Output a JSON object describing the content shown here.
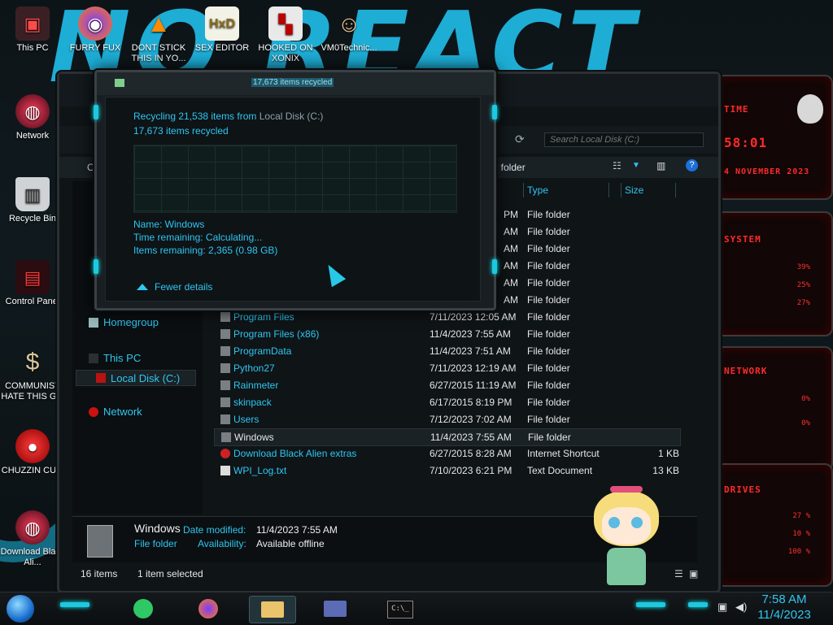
{
  "desktop": {
    "brand_text": "NO REACT",
    "icons": [
      {
        "label": "This PC"
      },
      {
        "label": "FURRY FUX"
      },
      {
        "label": "DONT STICK THIS IN YO..."
      },
      {
        "label": "SEX EDITOR"
      },
      {
        "label": "HOOKED ON XONIX"
      },
      {
        "label": "VM0Technic..."
      },
      {
        "label": "Network"
      },
      {
        "label": "Recycle Bin"
      },
      {
        "label": "Control Panel"
      },
      {
        "label": "COMMUNIST HATE THIS G..."
      },
      {
        "label": "CHUZZIN CUM"
      },
      {
        "label": "Download Black Ali..."
      }
    ]
  },
  "rainmeter": {
    "time_title": "TIME",
    "time_value": "58:01",
    "date_value": "4 NOVEMBER 2023",
    "system_title": "SYSTEM",
    "system_pcts": [
      "39%",
      "25%",
      "27%"
    ],
    "network_title": "NETWORK",
    "network_pcts": [
      "0%",
      "0%"
    ],
    "drives_title": "DRIVES",
    "drive_pcts": [
      "27 %",
      "10 %",
      "100 %"
    ]
  },
  "explorer": {
    "search_placeholder": "Search Local Disk (C:)",
    "toolbar_left": "Or",
    "toolbar_new_folder": "ew folder",
    "columns": {
      "type": "Type",
      "size": "Size"
    },
    "nav": {
      "homegroup": "Homegroup",
      "this_pc": "This PC",
      "local_disk": "Local Disk (C:)",
      "network": "Network"
    },
    "hidden_rows_times": [
      "PM",
      "AM",
      "AM",
      "AM",
      "AM",
      "AM"
    ],
    "hidden_rows_types": [
      "File folder",
      "File folder",
      "File folder",
      "File folder",
      "File folder",
      "File folder"
    ],
    "rows": [
      {
        "name": "Program Files",
        "date": "7/11/2023 12:05 AM",
        "type": "File folder",
        "size": ""
      },
      {
        "name": "Program Files (x86)",
        "date": "11/4/2023 7:55 AM",
        "type": "File folder",
        "size": ""
      },
      {
        "name": "ProgramData",
        "date": "11/4/2023 7:51 AM",
        "type": "File folder",
        "size": ""
      },
      {
        "name": "Python27",
        "date": "7/11/2023 12:19 AM",
        "type": "File folder",
        "size": ""
      },
      {
        "name": "Rainmeter",
        "date": "6/27/2015 11:19 AM",
        "type": "File folder",
        "size": ""
      },
      {
        "name": "skinpack",
        "date": "6/17/2015 8:19 PM",
        "type": "File folder",
        "size": ""
      },
      {
        "name": "Users",
        "date": "7/12/2023 7:02 AM",
        "type": "File folder",
        "size": ""
      },
      {
        "name": "Windows",
        "date": "11/4/2023 7:55 AM",
        "type": "File folder",
        "size": ""
      },
      {
        "name": "Download Black Alien extras",
        "date": "6/27/2015 8:28 AM",
        "type": "Internet Shortcut",
        "size": "1 KB"
      },
      {
        "name": "WPI_Log.txt",
        "date": "7/10/2023 6:21 PM",
        "type": "Text Document",
        "size": "13 KB"
      }
    ],
    "details": {
      "name": "Windows",
      "type": "File folder",
      "date_label": "Date modified:",
      "date_value": "11/4/2023 7:55 AM",
      "avail_label": "Availability:",
      "avail_value": "Available offline"
    },
    "status": {
      "count": "16 items",
      "selected": "1 item selected"
    }
  },
  "dialog": {
    "title": "17,673 items recycled",
    "line1_prefix": "Recycling 21,538 items from ",
    "line1_source": "Local Disk (C:)",
    "line2": "17,673 items recycled",
    "name": "Name:  Windows",
    "time_remaining": "Time remaining:  Calculating...",
    "items_remaining": "Items remaining:  2,365 (0.98 GB)",
    "fewer_details": "Fewer details"
  },
  "taskbar": {
    "time": "7:58 AM",
    "date": "11/4/2023"
  }
}
